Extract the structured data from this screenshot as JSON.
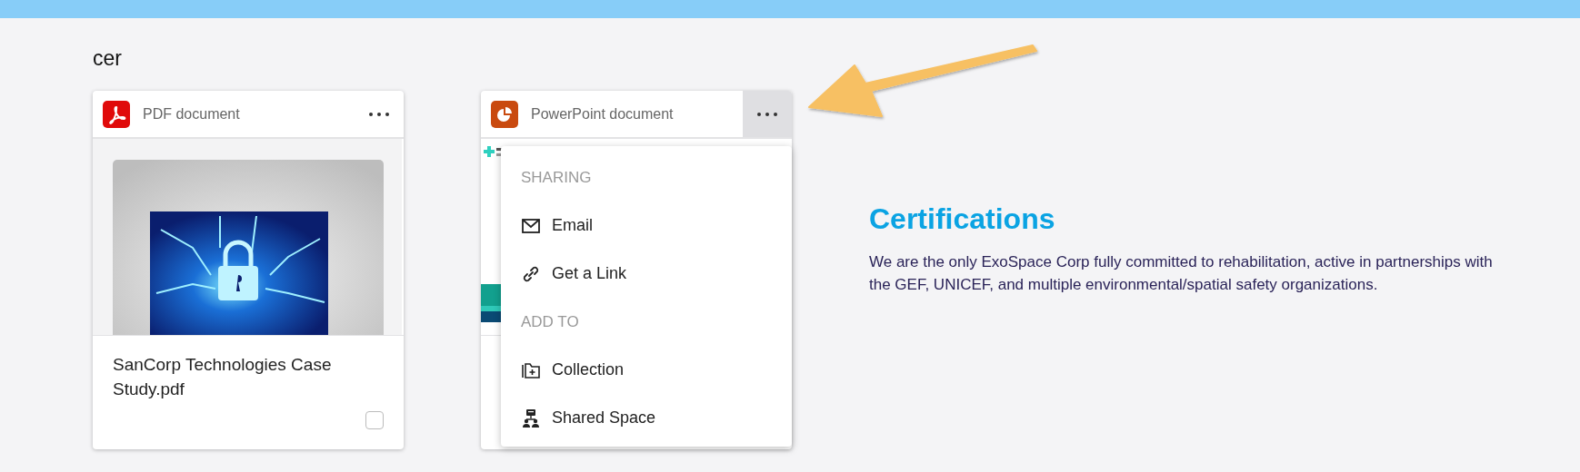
{
  "section_title": "cer",
  "cards": [
    {
      "kind": "pdf",
      "label": "PDF document",
      "title": "SanCorp Technologies Case Study.pdf",
      "checked": false,
      "menu_open": false
    },
    {
      "kind": "powerpoint",
      "label": "PowerPoint document",
      "menu_open": true
    }
  ],
  "menu": {
    "items": [
      {
        "kind": "header",
        "label": "SHARING"
      },
      {
        "kind": "item",
        "label": "Email"
      },
      {
        "kind": "item",
        "label": "Get a Link"
      },
      {
        "kind": "header",
        "label": "ADD TO"
      },
      {
        "kind": "item",
        "label": "Collection"
      },
      {
        "kind": "item",
        "label": "Shared Space"
      }
    ]
  },
  "info": {
    "heading": "Certifications",
    "text": "We are the only ExoSpace Corp fully committed to rehabilitation, active in partnerships with the GEF, UNICEF, and multiple environmental/spatial safety organizations."
  }
}
